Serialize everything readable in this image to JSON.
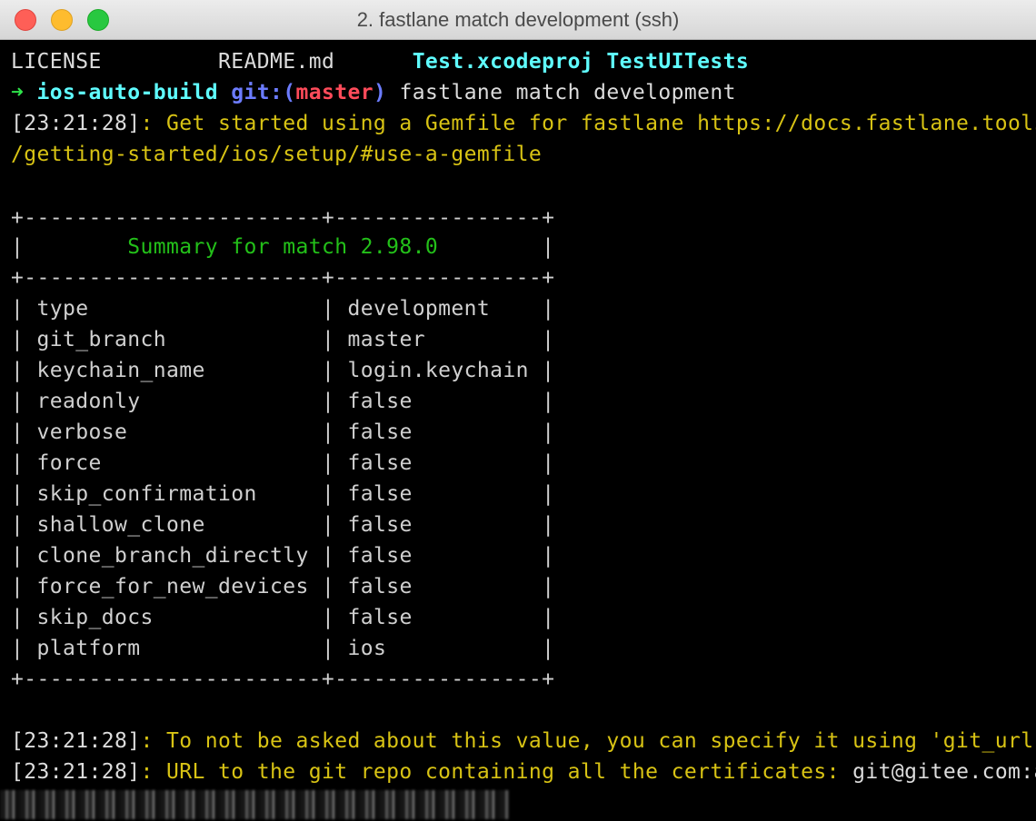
{
  "window": {
    "title": "2. fastlane match development (ssh)"
  },
  "terminal": {
    "ls_line": {
      "file1": "LICENSE",
      "file2": "README.md",
      "dir1": "Test.xcodeproj",
      "dir2": "TestUITests"
    },
    "prompt": {
      "arrow": "➜",
      "dir": "ios-auto-build",
      "git_label": "git:",
      "branch_open": "(",
      "branch": "master",
      "branch_close": ")",
      "command": "fastlane match development"
    },
    "info1_ts": "[23:21:28]",
    "info1_text": ": Get started using a Gemfile for fastlane https://docs.fastlane.tools",
    "info1_cont": "/getting-started/ios/setup/#use-a-gemfile",
    "table": {
      "border": "+-----------------------+----------------+",
      "title": "Summary for match 2.98.0",
      "rows": [
        {
          "key": "type",
          "value": "development"
        },
        {
          "key": "git_branch",
          "value": "master"
        },
        {
          "key": "keychain_name",
          "value": "login.keychain"
        },
        {
          "key": "readonly",
          "value": "false"
        },
        {
          "key": "verbose",
          "value": "false"
        },
        {
          "key": "force",
          "value": "false"
        },
        {
          "key": "skip_confirmation",
          "value": "false"
        },
        {
          "key": "shallow_clone",
          "value": "false"
        },
        {
          "key": "clone_branch_directly",
          "value": "false"
        },
        {
          "key": "force_for_new_devices",
          "value": "false"
        },
        {
          "key": "skip_docs",
          "value": "false"
        },
        {
          "key": "platform",
          "value": "ios"
        }
      ]
    },
    "info2_ts": "[23:21:28]",
    "info2_text": ": To not be asked about this value, you can specify it using 'git_url'",
    "info3_ts": "[23:21:28]",
    "info3_text": ": URL to the git repo containing all the certificates: ",
    "info3_value": "git@gitee.com:a"
  },
  "colors": {
    "background": "#000000",
    "cyan": "#5ffcff",
    "green": "#2ee34a",
    "yellow": "#d8c314",
    "blue": "#6c7cff",
    "red": "#ff4b5a"
  }
}
